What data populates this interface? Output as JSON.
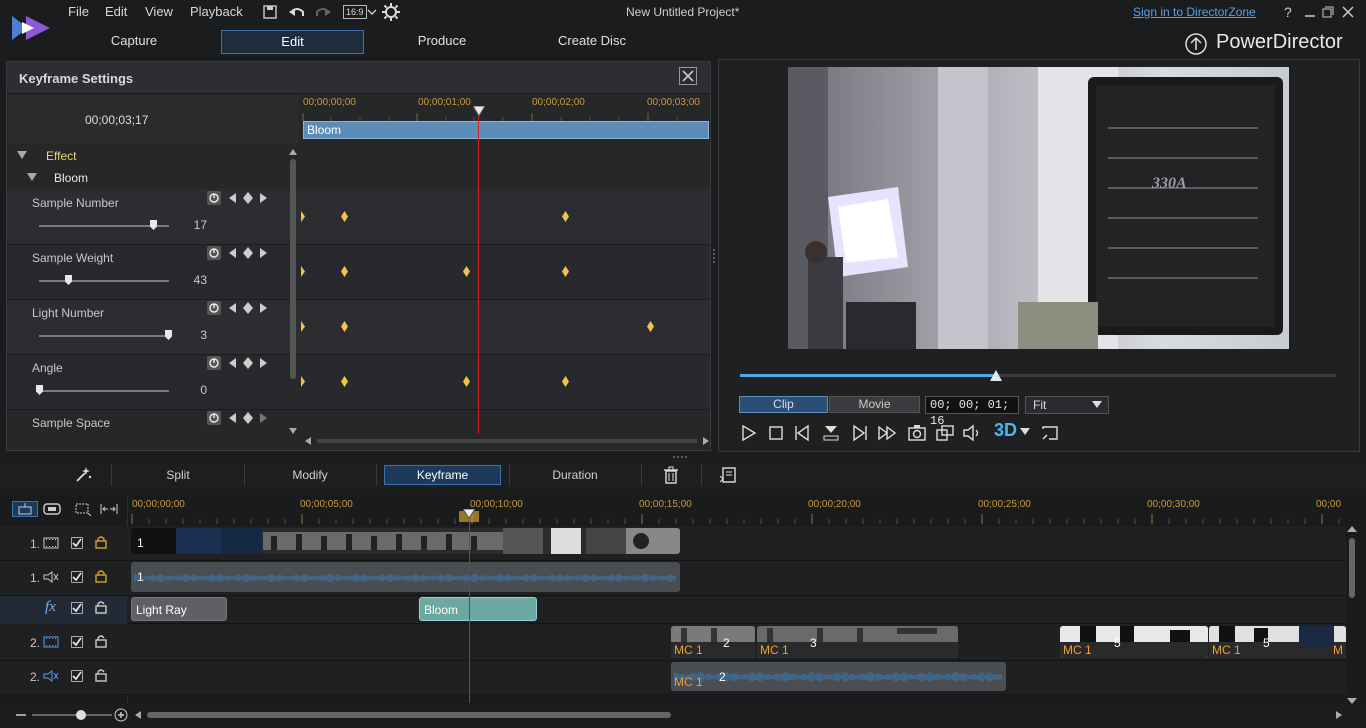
{
  "app": {
    "menu": [
      "File",
      "Edit",
      "View",
      "Playback"
    ],
    "aspect": "16:9",
    "project_title": "New Untitled Project*",
    "signin": "Sign in to DirectorZone",
    "help": "?",
    "brand": "PowerDirector",
    "modes": [
      "Capture",
      "Edit",
      "Produce",
      "Create Disc"
    ],
    "active_mode": "Edit"
  },
  "keyframe": {
    "title": "Keyframe Settings",
    "current_time": "00;00;03;17",
    "ruler": [
      "00;00;00;00",
      "00;00;01;00",
      "00;00;02;00",
      "00;00;03;00"
    ],
    "effect_bar": "Bloom",
    "tree": {
      "group": "Effect",
      "effect": "Bloom"
    },
    "params": [
      {
        "name": "Sample Number",
        "value": "17",
        "level": 0.88
      },
      {
        "name": "Sample Weight",
        "value": "43",
        "level": 0.22
      },
      {
        "name": "Light Number",
        "value": "3",
        "level": 0.99
      },
      {
        "name": "Angle",
        "value": "0",
        "level": 0.0
      },
      {
        "name": "Sample Space",
        "value": "",
        "level": null
      }
    ]
  },
  "preview": {
    "image_text": "330A",
    "clip_tab": "Clip",
    "movie_tab": "Movie",
    "timecode": "00; 00; 01; 16",
    "fit": "Fit",
    "threeD": "3D",
    "scrub_progress": 0.43
  },
  "toolbar": {
    "split": "Split",
    "modify": "Modify",
    "keyframe": "Keyframe",
    "duration": "Duration"
  },
  "timeline": {
    "ruler": [
      "00;00;00;00",
      "00;00;05;00",
      "00;00;10;00",
      "00;00;15;00",
      "00;00;20;00",
      "00;00;25;00",
      "00;00;30;00",
      "00;00"
    ],
    "tracks": [
      {
        "num": "1.",
        "type": "video"
      },
      {
        "num": "1.",
        "type": "audio"
      },
      {
        "num": "fx",
        "type": "fx"
      },
      {
        "num": "2.",
        "type": "video"
      },
      {
        "num": "2.",
        "type": "audio"
      }
    ],
    "clips": {
      "v1_label": "1",
      "a1_label": "1",
      "fx1": "Light Ray",
      "fx2": "Bloom",
      "v2": [
        "MC 1",
        "2",
        "MC 1",
        "3",
        "MC 1",
        "5",
        "MC 1",
        "5",
        "M"
      ],
      "a2": [
        "MC 1",
        "2"
      ]
    }
  },
  "colors": {
    "accent": "#3c72a8",
    "keyframe": "#f0c64a",
    "playhead": "#d02020",
    "effectbar": "#5b8db8"
  }
}
